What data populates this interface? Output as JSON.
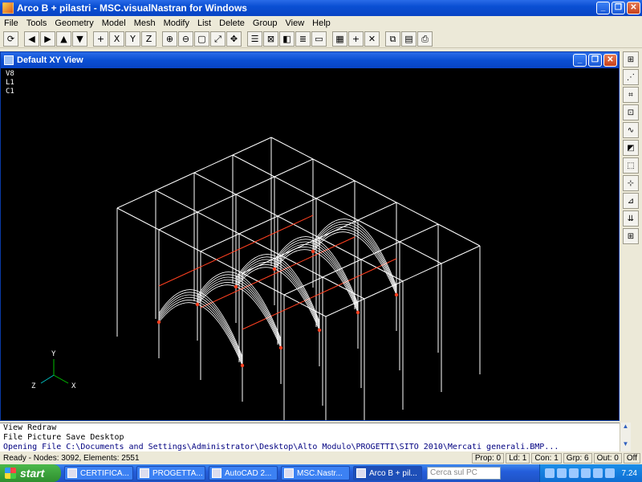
{
  "app": {
    "title": "Arco B + pilastri - MSC.visualNastran for Windows"
  },
  "menu": [
    "File",
    "Tools",
    "Geometry",
    "Model",
    "Mesh",
    "Modify",
    "List",
    "Delete",
    "Group",
    "View",
    "Help"
  ],
  "toolbar": {
    "buttons": [
      {
        "name": "rotate-icon",
        "glyph": "⟳"
      },
      {
        "name": "arrow-left-icon",
        "glyph": "◀"
      },
      {
        "name": "arrow-right-icon",
        "glyph": "▶"
      },
      {
        "name": "arrow-up-icon",
        "glyph": "▲"
      },
      {
        "name": "arrow-down-icon",
        "glyph": "▼"
      },
      {
        "name": "center-icon",
        "glyph": "+"
      },
      {
        "name": "rotate-x-icon",
        "glyph": "X"
      },
      {
        "name": "rotate-y-icon",
        "glyph": "Y"
      },
      {
        "name": "rotate-z-icon",
        "glyph": "Z"
      },
      {
        "name": "zoom-in-icon",
        "glyph": "⊕"
      },
      {
        "name": "zoom-out-icon",
        "glyph": "⊖"
      },
      {
        "name": "zoom-box-icon",
        "glyph": "▢"
      },
      {
        "name": "autoscale-icon",
        "glyph": "⤢"
      },
      {
        "name": "pan-icon",
        "glyph": "✥"
      },
      {
        "name": "list-icon",
        "glyph": "☰"
      },
      {
        "name": "wireframe-icon",
        "glyph": "⊠"
      },
      {
        "name": "solid-icon",
        "glyph": "◧"
      },
      {
        "name": "layers-icon",
        "glyph": "≣"
      },
      {
        "name": "window-icon",
        "glyph": "▭"
      },
      {
        "name": "grid-icon",
        "glyph": "▦"
      },
      {
        "name": "crosshair-icon",
        "glyph": "+"
      },
      {
        "name": "cross-icon",
        "glyph": "✕"
      },
      {
        "name": "copy-icon",
        "glyph": "⧉"
      },
      {
        "name": "clipboard-icon",
        "glyph": "▤"
      },
      {
        "name": "print-icon",
        "glyph": "⎙"
      }
    ]
  },
  "view": {
    "title": "Default XY View",
    "labels": [
      "V8",
      "L1",
      "C1"
    ],
    "axes": {
      "y": "Y",
      "z": "Z",
      "x": "X"
    }
  },
  "palette": [
    {
      "name": "palette-mesh-icon",
      "glyph": "⊞"
    },
    {
      "name": "palette-node-icon",
      "glyph": "⋰"
    },
    {
      "name": "palette-element-icon",
      "glyph": "⌗"
    },
    {
      "name": "palette-grid-icon",
      "glyph": "⊡"
    },
    {
      "name": "palette-curve-icon",
      "glyph": "∿"
    },
    {
      "name": "palette-surface-icon",
      "glyph": "◩"
    },
    {
      "name": "palette-solid-icon",
      "glyph": "⬚"
    },
    {
      "name": "palette-load-icon",
      "glyph": "⊹"
    },
    {
      "name": "palette-constraint-icon",
      "glyph": "⊿"
    },
    {
      "name": "palette-down-icon",
      "glyph": "⇊"
    },
    {
      "name": "palette-window-icon",
      "glyph": "⊞"
    }
  ],
  "output": {
    "lines": [
      "View Redraw",
      "File Picture Save Desktop",
      "Opening File C:\\Documents and Settings\\Administrator\\Desktop\\Alto Modulo\\PROGETTI\\SITO 2010\\Mercati generali.BMP..."
    ]
  },
  "status": {
    "left": "Ready - Nodes: 3092,  Elements: 2551",
    "cells": [
      "Prop: 0",
      "Ld: 1",
      "Con: 1",
      "Grp: 6",
      "Out: 0",
      "Off"
    ]
  },
  "taskbar": {
    "start": "start",
    "tasks": [
      "CERTIFICA...",
      "PROGETTA...",
      "AutoCAD 2...",
      "MSC.Nastr...",
      "Arco B + pil..."
    ],
    "search_placeholder": "Cerca sul PC",
    "clock": "7.24"
  },
  "colors": {
    "viewport_bg": "#000000",
    "wire": "#ffffff",
    "beam": "#ff4020",
    "xp_blue": "#0a4fd3"
  }
}
